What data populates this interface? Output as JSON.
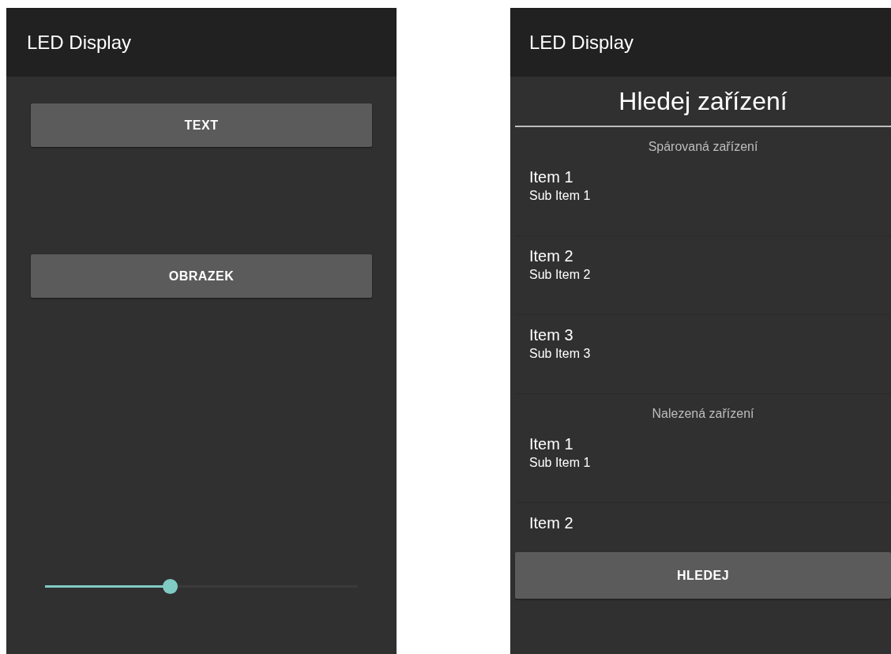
{
  "main_screen": {
    "title": "LED Display",
    "buttons": [
      "TEXT",
      "OBRAZEK"
    ],
    "slider": {
      "level": 0.4
    }
  },
  "search_screen": {
    "title": "LED Display",
    "heading": "Hledej zařízení",
    "sections": [
      {
        "title": "Spárovaná zařízení",
        "items": [
          {
            "title": "Item 1",
            "subtitle": "Sub Item 1"
          },
          {
            "title": "Item 2",
            "subtitle": "Sub Item 2"
          },
          {
            "title": "Item 3",
            "subtitle": "Sub Item 3"
          }
        ]
      },
      {
        "title": "Nalezená zařízení",
        "items": [
          {
            "title": "Item 1",
            "subtitle": "Sub Item 1"
          },
          {
            "title": "Item 2"
          }
        ]
      }
    ],
    "button": "HLEDEJ"
  }
}
